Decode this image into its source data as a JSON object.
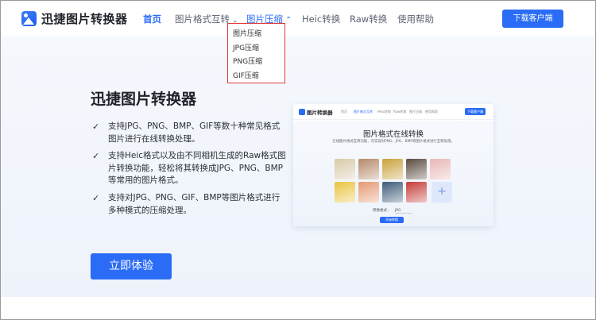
{
  "header": {
    "logo_text": "迅捷图片转换器",
    "nav": [
      {
        "label": "首页"
      },
      {
        "label": "图片格式互转"
      },
      {
        "label": "图片压缩"
      },
      {
        "label": "Heic转换"
      },
      {
        "label": "Raw转换"
      },
      {
        "label": "使用帮助"
      }
    ],
    "download_label": "下载客户端"
  },
  "dropdown": {
    "items": [
      "图片压缩",
      "JPG压缩",
      "PNG压缩",
      "GIF压缩"
    ]
  },
  "hero": {
    "title": "迅捷图片转换器",
    "features": [
      "支持JPG、PNG、BMP、GIF等数十种常见格式图片进行在线转换处理。",
      "支持Heic格式以及由不同相机生成的Raw格式图片转换功能，轻松将其转换成JPG、PNG、BMP等常用的图片格式。",
      "支持对JPG、PNG、GIF、BMP等图片格式进行多种模式的压缩处理。"
    ],
    "try_label": "立即体验"
  },
  "preview": {
    "logo_text": "图片转换器",
    "nav": [
      "首页",
      "图片格式互转",
      "Heic转换",
      "Raw转换",
      "图片压缩",
      "使用帮助"
    ],
    "button": "下载客户端",
    "title": "图片格式在线转换",
    "subtitle": "在线图片格式互转功能，可实现对PNG、JPG、BMP等图片格式进行互转处理。",
    "format_label": "转换格式：",
    "format_value": "JPG",
    "start_label": "开始转换",
    "thumb_colors": [
      "#d8c9a8",
      "#b58a6a",
      "#c9a13a",
      "#5a4a3e",
      "#e8b7b5",
      "#e9c441",
      "#e59a73",
      "#3e5b7a",
      "#c43d3a"
    ]
  },
  "colors": {
    "accent": "#2b6cf6",
    "highlight_border": "#e23a3a"
  },
  "icons": {
    "check": "check-icon",
    "chevron": "chevron-icon",
    "plus": "plus-icon"
  }
}
